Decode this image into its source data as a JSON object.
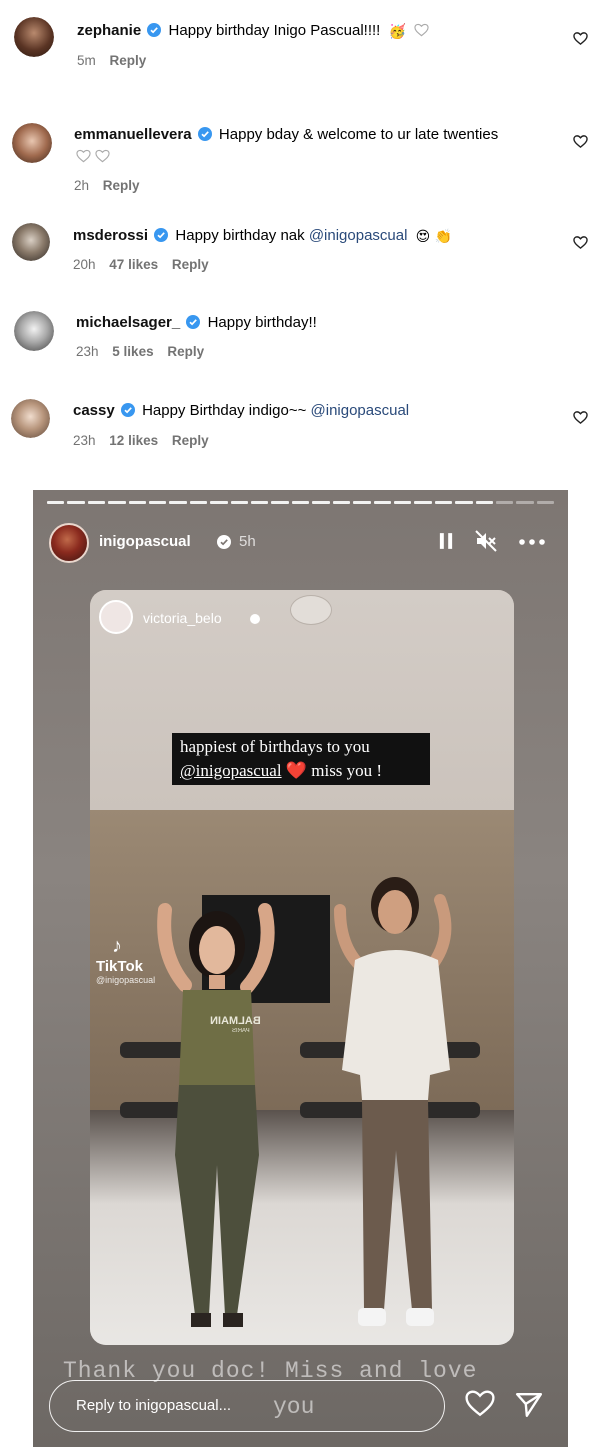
{
  "colors": {
    "verified": "#3897f0",
    "meta_gray": "#737373",
    "mention": "#2a4a7a"
  },
  "comments": [
    {
      "username": "zephanie",
      "text": "Happy birthday Inigo Pascual!!!!",
      "emoji": "🥳",
      "time": "5m",
      "likes": "",
      "reply": "Reply"
    },
    {
      "username": "emmanuellevera",
      "text": "Happy bday & welcome to ur late twenties",
      "time": "2h",
      "likes": "",
      "reply": "Reply"
    },
    {
      "username": "msderossi",
      "text": "Happy birthday nak ",
      "mention": "@inigopascual",
      "emoji": "😍 👏",
      "time": "20h",
      "likes": "47 likes",
      "reply": "Reply"
    },
    {
      "username": "michaelsager_",
      "text": "Happy birthday!!",
      "time": "23h",
      "likes": "5 likes",
      "reply": "Reply"
    },
    {
      "username": "cassy",
      "text": "Happy Birthday indigo~~ ",
      "mention": "@inigopascual",
      "time": "23h",
      "likes": "12 likes",
      "reply": "Reply"
    }
  ],
  "story": {
    "username": "inigopascual",
    "time": "5h",
    "reposted_user": "victoria_belo",
    "caption_line1": "happiest of birthdays to you",
    "caption_mention": "@inigopascual",
    "caption_heart": "❤️",
    "caption_line2_rest": " miss you !",
    "tiktok_label": "TikTok",
    "tiktok_handle": "@inigopascual",
    "shirt_text": "BALMAIN",
    "shirt_sub": "PARIS",
    "overlay_line1": "Thank you doc! Miss and love",
    "overlay_line2": "you",
    "reply_placeholder": "Reply to inigopascual..."
  },
  "icons": [
    "verified-badge-icon",
    "heart-icon",
    "pause-icon",
    "muted-speaker-icon",
    "more-options-icon",
    "send-icon"
  ]
}
